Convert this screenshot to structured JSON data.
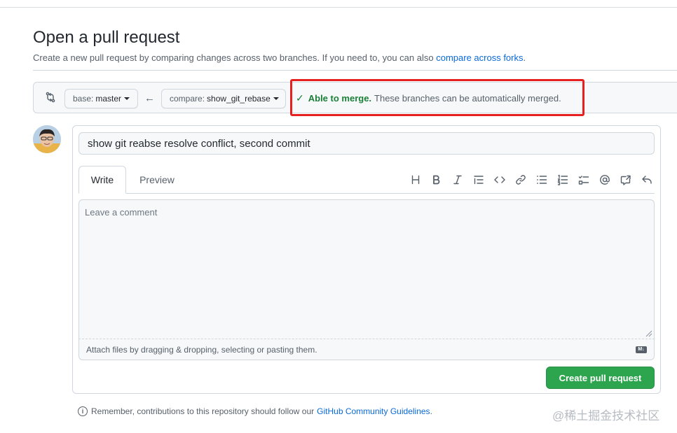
{
  "header": {
    "title": "Open a pull request",
    "subtitle": "Create a new pull request by comparing changes across two branches. If you need to, you can also",
    "subtitle_link": "compare across forks",
    "subtitle_end": "."
  },
  "range": {
    "base_prefix": "base:",
    "base_branch": "master",
    "compare_prefix": "compare:",
    "compare_branch": "show_git_rebase",
    "merge_ok": "Able to merge.",
    "merge_text": "These branches can be automatically merged."
  },
  "composer": {
    "title_value": "show git reabse resolve conflict, second commit",
    "tabs": [
      "Write",
      "Preview"
    ],
    "comment_placeholder": "Leave a comment",
    "attach_text": "Attach files by dragging & dropping, selecting or pasting them.",
    "markdown_badge": "M↓",
    "submit_label": "Create pull request"
  },
  "toolbar_icons": [
    "heading-icon",
    "bold-icon",
    "italic-icon",
    "quote-icon",
    "code-icon",
    "link-icon",
    "unordered-list-icon",
    "ordered-list-icon",
    "task-list-icon",
    "mention-icon",
    "cross-reference-icon",
    "reply-icon"
  ],
  "footer": {
    "note": "Remember, contributions to this repository should follow our",
    "link": "GitHub Community Guidelines",
    "end": "."
  },
  "watermark": "@稀土掘金技术社区",
  "colors": {
    "accent": "#0969da",
    "success": "#1a7f37",
    "primary_button": "#2da44e",
    "highlight_box": "#e5201f"
  }
}
